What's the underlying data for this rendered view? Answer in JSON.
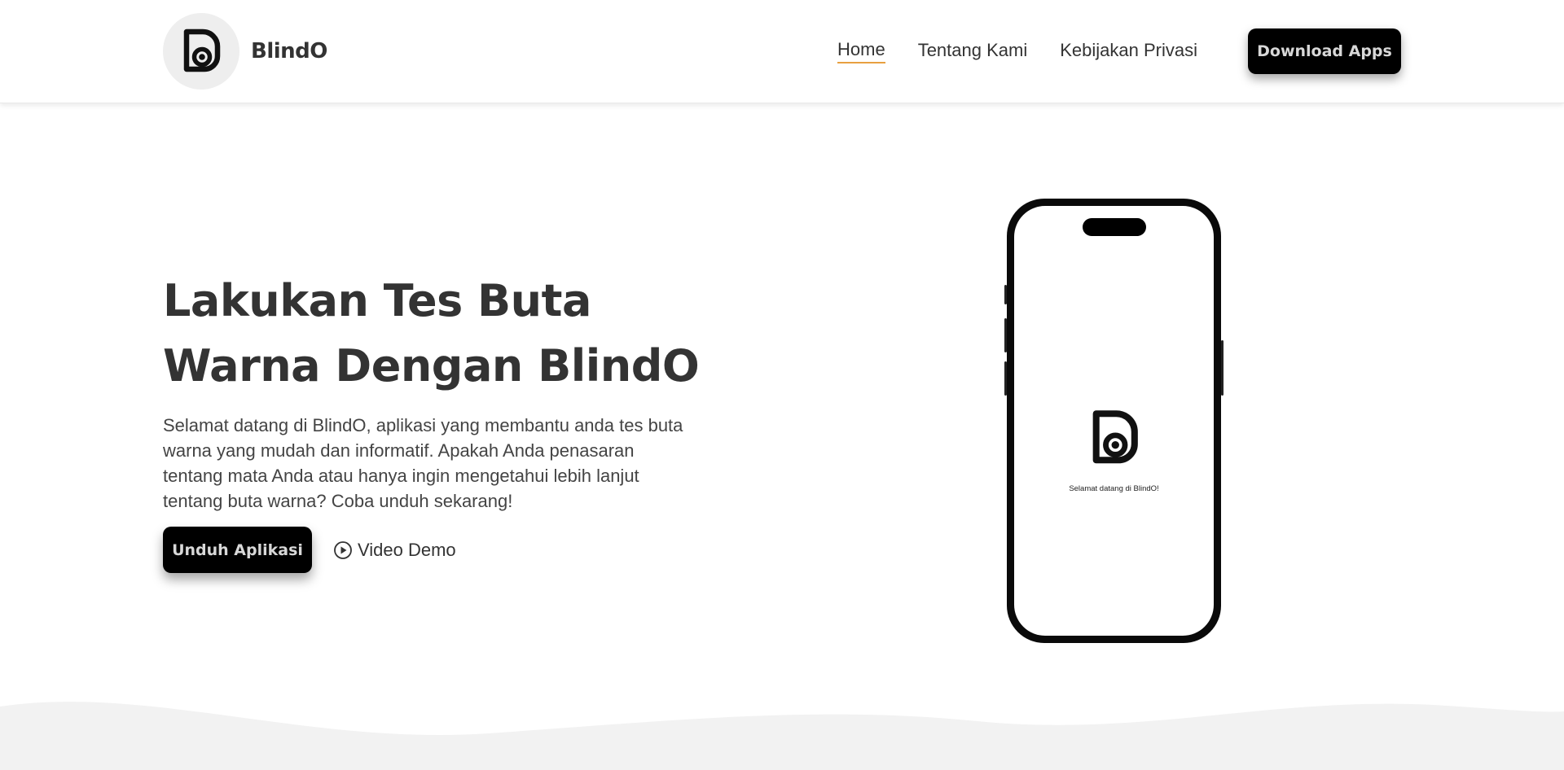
{
  "header": {
    "brand_name": "BlindO",
    "nav": [
      {
        "label": "Home",
        "active": true
      },
      {
        "label": "Tentang Kami",
        "active": false
      },
      {
        "label": "Kebijakan Privasi",
        "active": false
      }
    ],
    "download_label": "Download Apps"
  },
  "hero": {
    "title_line1": "Lakukan Tes Buta",
    "title_line2": "Warna Dengan BlindO",
    "description": "Selamat datang di BlindO, aplikasi yang  membantu anda tes buta warna yang mudah dan informatif. Apakah Anda penasaran tentang mata Anda atau hanya ingin mengetahui lebih lanjut tentang buta warna? Coba unduh sekarang!",
    "cta_label": "Unduh Aplikasi",
    "video_label": "Video Demo"
  },
  "phone": {
    "splash_text": "Selamat datang di BlindO!"
  },
  "colors": {
    "accent_underline": "#e8a040",
    "button_bg": "#000000",
    "button_text": "#d8d8d8",
    "wave": "#f2f2f2",
    "logo_bg": "#eeeeee"
  },
  "icons": {
    "brand": "blindo-logo-icon",
    "video": "play-circle-icon"
  }
}
